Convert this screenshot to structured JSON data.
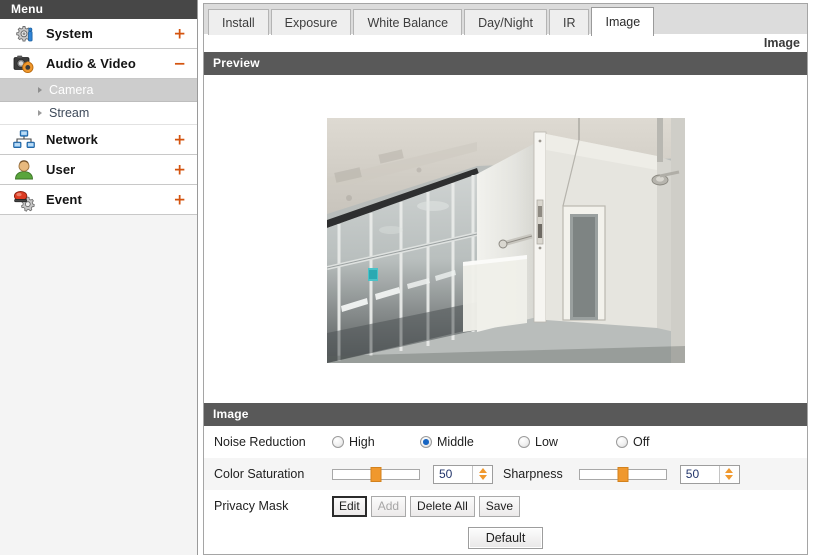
{
  "sidebar": {
    "header": "Menu",
    "items": [
      {
        "label": "System",
        "icon": "system-gear-icon",
        "toggle": "+"
      },
      {
        "label": "Audio & Video",
        "icon": "camera-icon",
        "toggle": "−"
      },
      {
        "label": "Network",
        "icon": "network-icon",
        "toggle": "+"
      },
      {
        "label": "User",
        "icon": "user-icon",
        "toggle": "+"
      },
      {
        "label": "Event",
        "icon": "event-alarm-icon",
        "toggle": "+"
      }
    ],
    "subitems": [
      {
        "label": "Camera",
        "active": true
      },
      {
        "label": "Stream",
        "active": false
      }
    ]
  },
  "tabs": [
    {
      "label": "Install",
      "active": false
    },
    {
      "label": "Exposure",
      "active": false
    },
    {
      "label": "White Balance",
      "active": false
    },
    {
      "label": "Day/Night",
      "active": false
    },
    {
      "label": "IR",
      "active": false
    },
    {
      "label": "Image",
      "active": true
    }
  ],
  "page_title": "Image",
  "preview": {
    "section_title": "Preview",
    "description": "Live camera preview of an office corridor with glass partition walls and a white door"
  },
  "image_settings": {
    "section_title": "Image",
    "noise_reduction": {
      "label": "Noise Reduction",
      "options": [
        "High",
        "Middle",
        "Low",
        "Off"
      ],
      "selected": "Middle"
    },
    "color_saturation": {
      "label": "Color Saturation",
      "value": "50",
      "min": 0,
      "max": 100
    },
    "sharpness": {
      "label": "Sharpness",
      "value": "50",
      "min": 0,
      "max": 100
    },
    "privacy_mask": {
      "label": "Privacy Mask",
      "buttons": [
        {
          "label": "Edit",
          "state": "focused"
        },
        {
          "label": "Add",
          "state": "disabled"
        },
        {
          "label": "Delete All",
          "state": "normal"
        },
        {
          "label": "Save",
          "state": "normal"
        }
      ]
    },
    "default_button": "Default"
  },
  "colors": {
    "accent": "#d4540f",
    "slider_knob": "#f0982d",
    "section_bar": "#595959",
    "menu_header": "#474747",
    "radio_selected": "#1765c2"
  }
}
